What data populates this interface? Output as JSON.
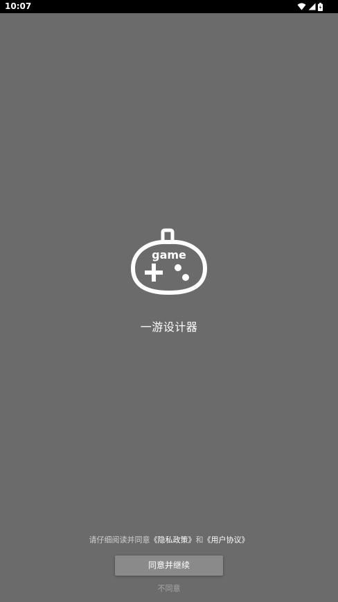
{
  "status_bar": {
    "time": "10:07",
    "icons": [
      "wifi-icon",
      "signal-icon",
      "battery-icon"
    ]
  },
  "app": {
    "logo_text": "game",
    "name": "一游设计器"
  },
  "agreement": {
    "prefix": "请仔细阅读并同意",
    "privacy_link": "《隐私政策》",
    "conjunction": "和",
    "user_link": "《用户协议》"
  },
  "buttons": {
    "agree_label": "同意并继续",
    "disagree_label": "不同意"
  },
  "colors": {
    "background": "#6b6b6b",
    "status_bar": "#000000",
    "button": "#8a8a8a",
    "text": "#ffffff"
  }
}
